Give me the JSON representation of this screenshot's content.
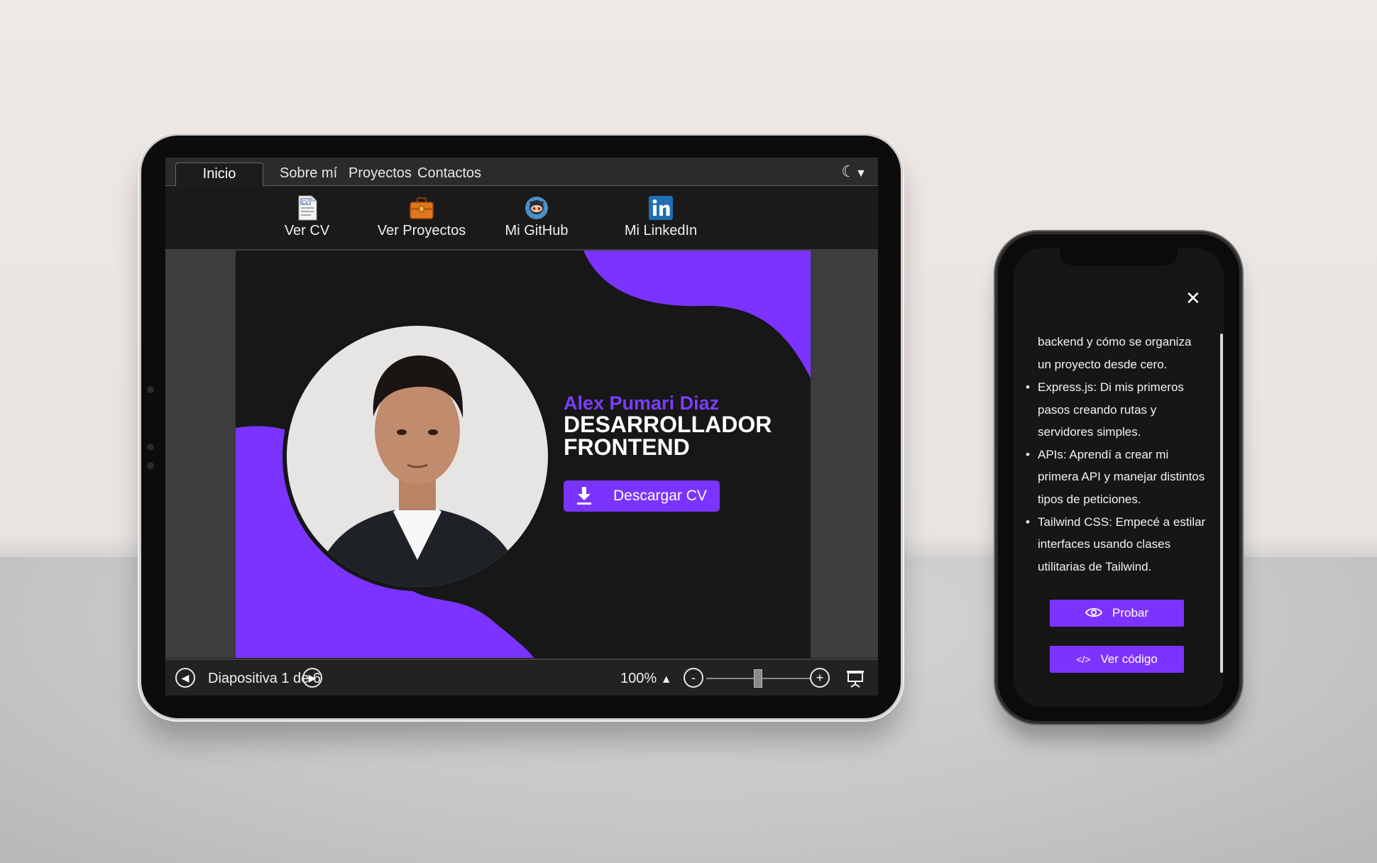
{
  "tablet": {
    "tabs": [
      {
        "label": "Inicio",
        "active": true
      },
      {
        "label": "Sobre mí",
        "active": false
      },
      {
        "label": "Proyectos",
        "active": false
      },
      {
        "label": "Contactos",
        "active": false
      }
    ],
    "theme_toggle_icon": "moon-icon",
    "ribbon": [
      {
        "label": "Ver CV",
        "icon": "cv-document-icon"
      },
      {
        "label": "Ver Proyectos",
        "icon": "briefcase-icon"
      },
      {
        "label": "Mi GitHub",
        "icon": "github-octocat-icon"
      },
      {
        "label": "Mi LinkedIn",
        "icon": "linkedin-icon"
      }
    ],
    "slide": {
      "name": "Alex Pumari Diaz",
      "role_line1": "DESARROLLADOR",
      "role_line2": "FRONTEND",
      "download_button": "Descargar CV",
      "accent_color": "#7b33ff"
    },
    "statusbar": {
      "slide_counter": "Diapositiva 1 de 6",
      "zoom": "100%",
      "zoom_minus": "-",
      "zoom_plus": "+"
    }
  },
  "phone": {
    "paragraph": "backend y cómo se organiza un proyecto desde cero.",
    "list": [
      "Express.js: Di mis primeros pasos creando rutas y servidores simples.",
      "APIs: Aprendí a crear mi primera API y manejar distintos tipos de peticiones.",
      "Tailwind CSS: Empecé a estilar interfaces usando clases utilitarias de Tailwind."
    ],
    "try_button": "Probar",
    "code_button": "Ver código",
    "code_icon": "</>"
  }
}
